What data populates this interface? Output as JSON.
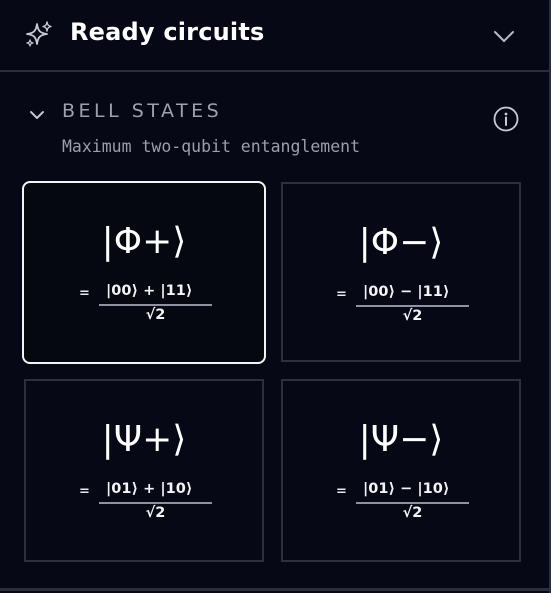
{
  "header": {
    "title": "Ready circuits",
    "icon": "sparkle-icon",
    "collapse_icon": "chevron-down-icon"
  },
  "section": {
    "title": "BELL STATES",
    "subtitle": "Maximum two-qubit entanglement",
    "toggle_icon": "chevron-down-icon",
    "info_icon": "info-icon"
  },
  "cards": [
    {
      "state": "|Φ+⟩",
      "eq": "=",
      "numerator": "|00⟩ + |11⟩",
      "denominator": "√2",
      "selected": true
    },
    {
      "state": "|Φ−⟩",
      "eq": "=",
      "numerator": "|00⟩ − |11⟩",
      "denominator": "√2",
      "selected": false
    },
    {
      "state": "|Ψ+⟩",
      "eq": "=",
      "numerator": "|01⟩ + |10⟩",
      "denominator": "√2",
      "selected": false
    },
    {
      "state": "|Ψ−⟩",
      "eq": "=",
      "numerator": "|01⟩ − |10⟩",
      "denominator": "√2",
      "selected": false
    }
  ],
  "colors": {
    "background": "#060816",
    "border": "#2a2d3c",
    "selected_border": "#f4f4f6",
    "muted_text": "#9da0ad"
  }
}
